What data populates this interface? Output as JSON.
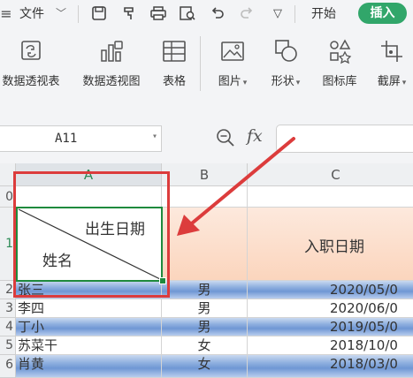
{
  "titlebar": {
    "menu_file": "文件",
    "tabs": [
      {
        "label": "开始"
      },
      {
        "label": "插入"
      }
    ]
  },
  "ribbon": {
    "items": [
      {
        "label": "数据透视表",
        "icon": "pivot-table-icon"
      },
      {
        "label": "数据透视图",
        "icon": "pivot-chart-icon"
      },
      {
        "label": "表格",
        "icon": "table-icon"
      },
      {
        "label": "图片",
        "icon": "picture-icon",
        "dropdown": true
      },
      {
        "label": "形状",
        "icon": "shape-icon",
        "dropdown": true
      },
      {
        "label": "图标库",
        "icon": "icon-library-icon"
      },
      {
        "label": "截屏",
        "icon": "screenshot-icon",
        "dropdown": true
      }
    ]
  },
  "formula_bar": {
    "name_box": "A11",
    "fx": "fx",
    "formula": ""
  },
  "sheet": {
    "columns": [
      "A",
      "B",
      "C"
    ],
    "rows": [
      "0",
      "1",
      "2",
      "3",
      "4",
      "5",
      "6"
    ],
    "header_cell": {
      "top_right": "出生日期",
      "bottom_left": "姓名",
      "c_header": "入职日期"
    },
    "data": [
      {
        "name": "张三",
        "gender": "男",
        "date": "2020/05/0"
      },
      {
        "name": "李四",
        "gender": "男",
        "date": "2020/06/0"
      },
      {
        "name": "丁小",
        "gender": "男",
        "date": "2019/05/0"
      },
      {
        "name": "苏菜干",
        "gender": "女",
        "date": "2018/10/0"
      },
      {
        "name": "肖黄",
        "gender": "女",
        "date": "2018/03/0"
      }
    ]
  },
  "colors": {
    "accent_green": "#31a66a",
    "annotation_red": "#dc3c3c",
    "selection_green": "#1f8a3d"
  }
}
